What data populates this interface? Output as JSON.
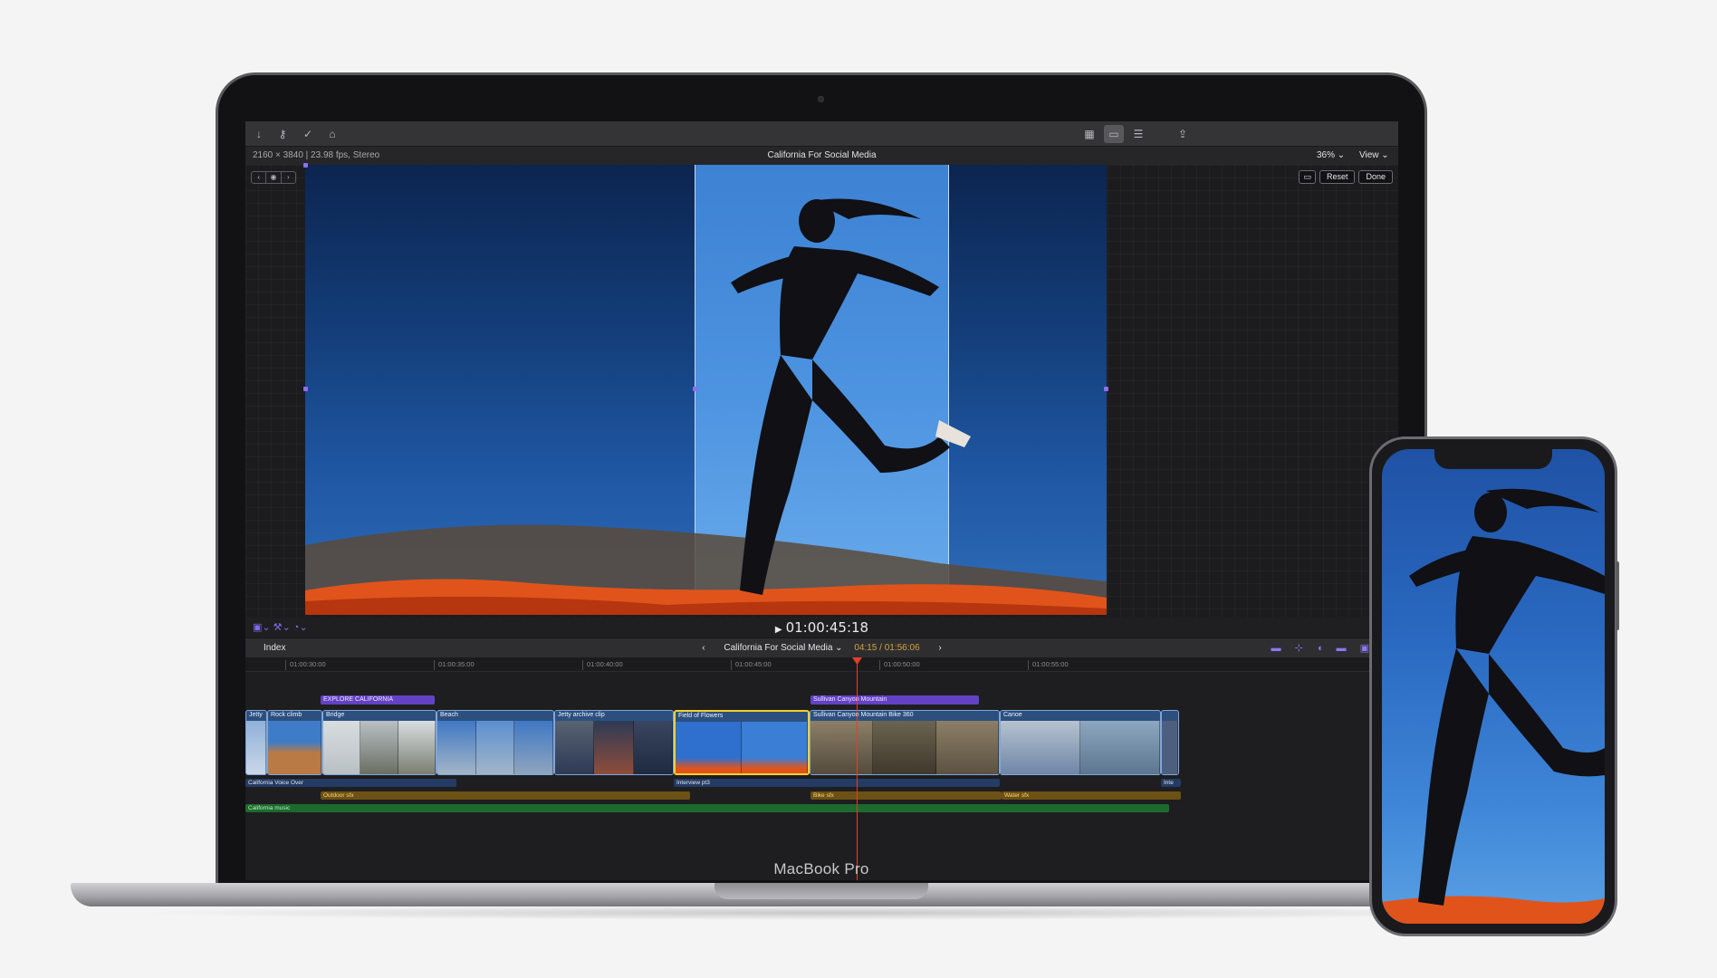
{
  "device": {
    "brand": "MacBook Pro"
  },
  "toolbar": {
    "left_icons": [
      "import-icon",
      "keywords-icon",
      "check-icon",
      "tag-icon"
    ],
    "right_icons": [
      "browser-icon",
      "timeline-icon",
      "inspector-icon",
      "share-icon"
    ]
  },
  "info": {
    "format": "2160 × 3840 | 23.98 fps, Stereo",
    "project_title": "California For Social Media",
    "zoom": "36% ⌄",
    "view": "View ⌄"
  },
  "viewer": {
    "reset": "Reset",
    "done": "Done",
    "nav_glyphs": [
      "‹",
      "◉",
      "›"
    ],
    "tool_glyphs": "▣⌄  ⚒⌄  ◔⌄"
  },
  "playback": {
    "play": "▶",
    "timecode": "01:00:45:18"
  },
  "timeline_bar": {
    "index": "Index",
    "project": "California For Social Media ⌄",
    "duration": "04:15 / 01:56:06",
    "prev": "‹",
    "next": "›",
    "right_tools": "▬ ⊹ ◖ ▬ ▣"
  },
  "ruler": [
    "01:00:30:00",
    "01:00:35:00",
    "01:00:40:00",
    "01:00:45:00",
    "01:00:50:00",
    "01:00:55:00"
  ],
  "titles": [
    {
      "label": "EXPLORE CALIFORNIA"
    },
    {
      "label": "Sullivan Canyon Mountain"
    }
  ],
  "clips": [
    {
      "label": "Jetty",
      "colors": [
        "#8fb1d8",
        "#c9d7e8"
      ]
    },
    {
      "label": "Rock climb",
      "colors": [
        "#3f7cc7",
        "#b97a45"
      ]
    },
    {
      "label": "Bridge",
      "colors": [
        "#b9c0c4",
        "#6a6f62",
        "#d8dde0"
      ]
    },
    {
      "label": "Beach",
      "colors": [
        "#3f78c4",
        "#5b8fd0",
        "#a3b5c7"
      ]
    },
    {
      "label": "Jetty archive clip",
      "colors": [
        "#586272",
        "#2d3a55",
        "#8f4d3b"
      ]
    },
    {
      "label": "Field of Flowers",
      "colors": [
        "#2f6fce",
        "#3a7ed6"
      ]
    },
    {
      "label": "Sullivan Canyon Mountain Bike 360",
      "colors": [
        "#6b6450",
        "#8b7f66",
        "#544b3d"
      ]
    },
    {
      "label": "Canoe",
      "colors": [
        "#6f86a8",
        "#8ea7c0",
        "#b6c3cf"
      ]
    },
    {
      "label": "",
      "colors": [
        "#4d5f7e"
      ]
    }
  ],
  "audio": {
    "voice_over": "California Voice Over",
    "interview": "Interview pt3",
    "interview_tail": "Inte",
    "outdoor": "Outdoor sfx",
    "bike": "Bike sfx",
    "water": "Water sfx",
    "music": "California music"
  },
  "colors": {
    "playhead": "#e2402a",
    "selection": "#f1d22a",
    "title_clip": "#6442c4",
    "accent": "#8a78f4"
  }
}
